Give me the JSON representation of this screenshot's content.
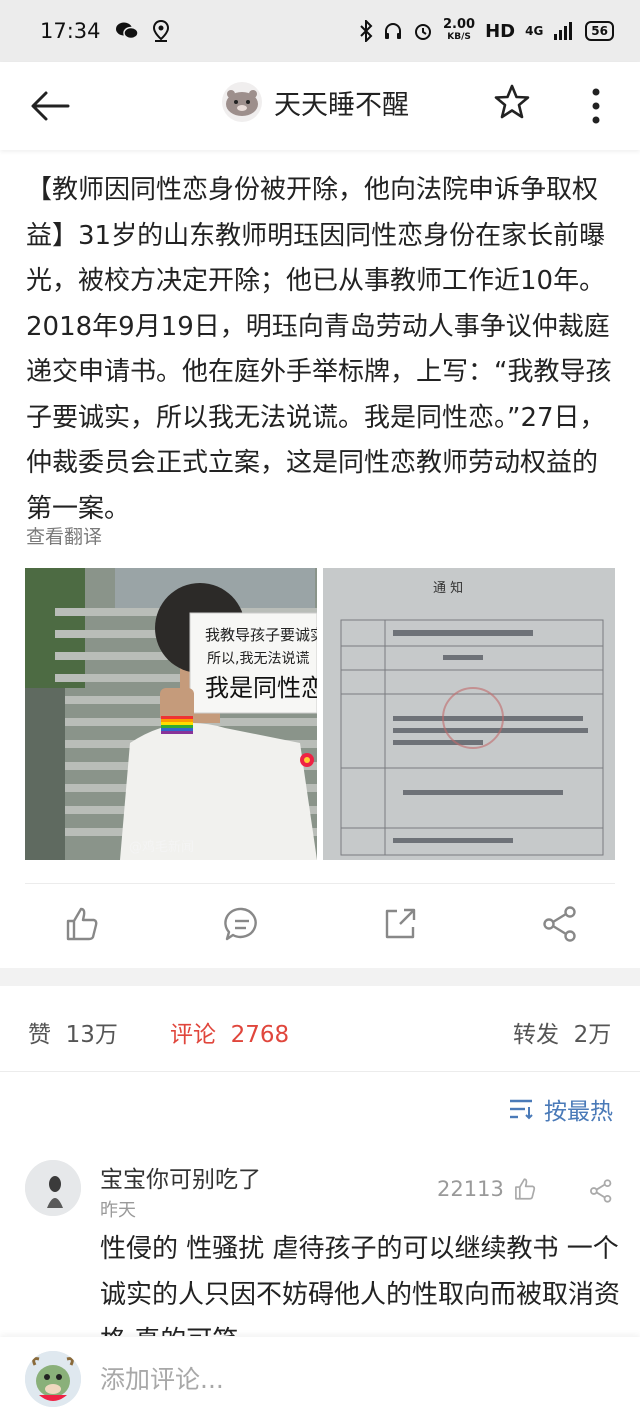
{
  "status": {
    "time": "17:34",
    "speed_value": "2.00",
    "speed_unit": "KB/S",
    "hd": "HD",
    "network": "4G",
    "battery": "56"
  },
  "header": {
    "username": "天天睡不醒"
  },
  "post": {
    "text": "【教师因同性恋身份被开除，他向法院申诉争取权益】31岁的山东教师明珏因同性恋身份在家长前曝光，被校方决定开除；他已从事教师工作近10年。2018年9月19日，明珏向青岛劳动人事争议仲裁庭递交申请书。他在庭外手举标牌，上写：“我教导孩子要诚实，所以我无法说谎。我是同性恋。”27日，仲裁委员会正式立案，这是同性恋教师劳动权益的第一案。",
    "translate_label": "查看翻译",
    "image1": {
      "sign_line1": "我教导孩子要诚实",
      "sign_line2": "所以,我无法说谎",
      "sign_line3": "我是同性恋",
      "watermark": "@鸡毛新闻"
    },
    "image2": {
      "title": "通 知"
    }
  },
  "stats": {
    "likes_label": "赞",
    "likes_value": "13万",
    "comments_label": "评论",
    "comments_value": "2768",
    "reposts_label": "转发",
    "reposts_value": "2万"
  },
  "sort": {
    "label": "按最热"
  },
  "comment": {
    "author": "宝宝你可别吃了",
    "time": "昨天",
    "likes": "22113",
    "text": "性侵的 性骚扰 虐待孩子的可以继续教书 一个诚实的人只因不妨碍他人的性取向而被取消资格 真的可笑"
  },
  "composer": {
    "placeholder": "添加评论..."
  },
  "colors": {
    "accent_red": "#e0463c",
    "link_blue": "#4a7ab8"
  }
}
